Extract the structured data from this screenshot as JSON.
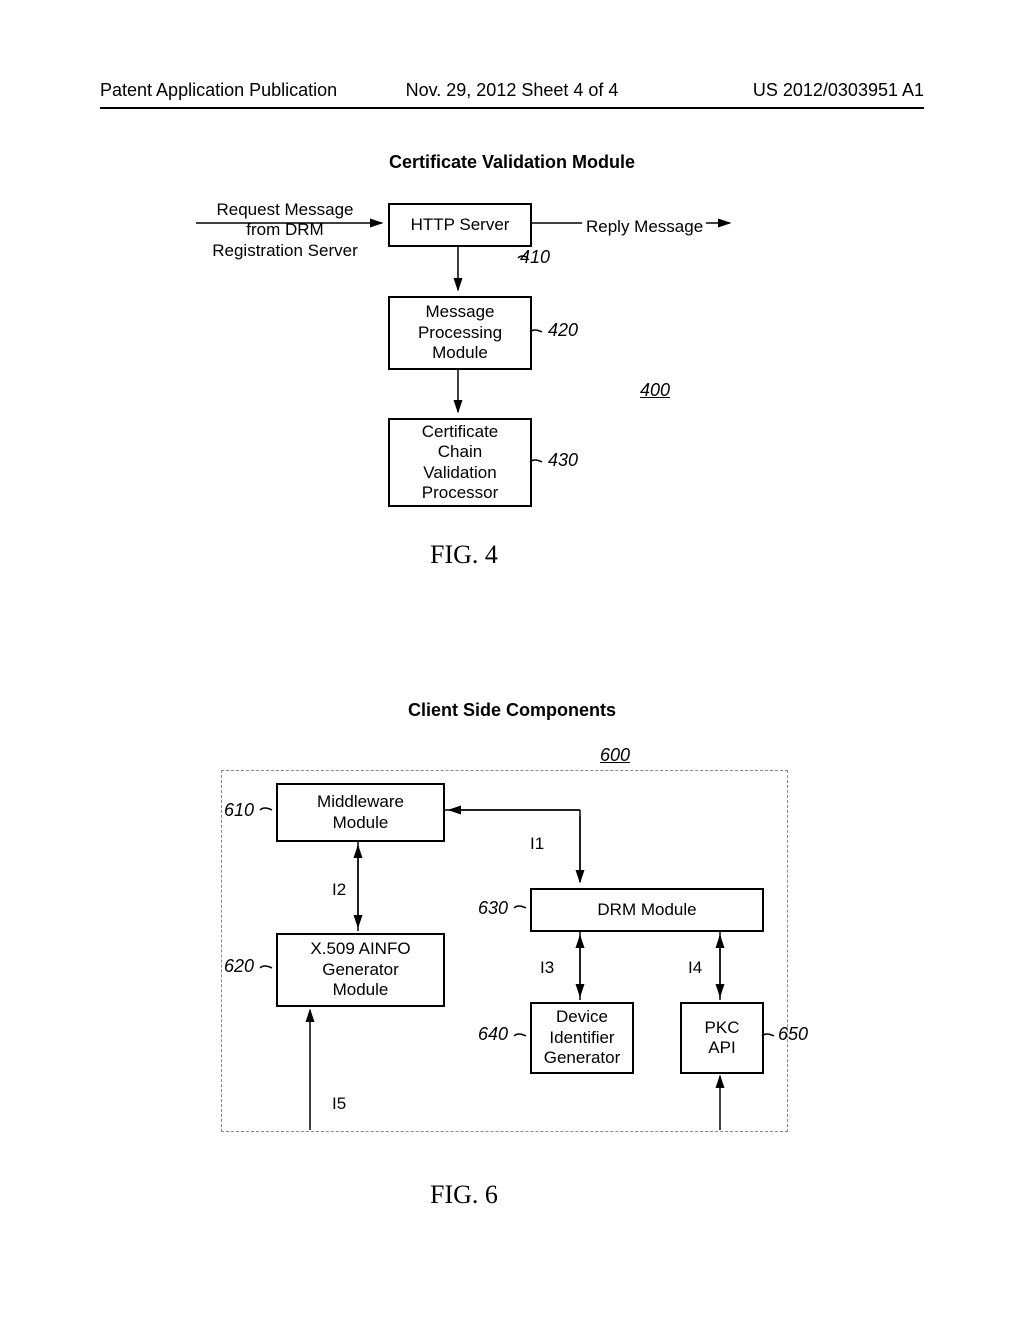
{
  "header": {
    "left": "Patent Application Publication",
    "center": "Nov. 29, 2012 Sheet 4 of 4",
    "right": "US 2012/0303951 A1"
  },
  "fig4": {
    "title": "Certificate Validation Module",
    "request_label": "Request Message\nfrom DRM\nRegistration Server",
    "reply_label": "Reply Message",
    "box410": "HTTP Server",
    "box420": "Message\nProcessing\nModule",
    "box430": "Certificate\nChain\nValidation\nProcessor",
    "ref410": "410",
    "ref420": "420",
    "ref430": "430",
    "ref400": "400",
    "caption": "FIG. 4"
  },
  "fig6": {
    "title": "Client Side Components",
    "box610": "Middleware\nModule",
    "box620": "X.509 AINFO\nGenerator\nModule",
    "box630": "DRM Module",
    "box640": "Device\nIdentifier\nGenerator",
    "box650": "PKC\nAPI",
    "i1": "I1",
    "i2": "I2",
    "i3": "I3",
    "i4": "I4",
    "i5": "I5",
    "ref600": "600",
    "ref610": "610",
    "ref620": "620",
    "ref630": "630",
    "ref640": "640",
    "ref650": "650",
    "caption": "FIG. 6"
  }
}
